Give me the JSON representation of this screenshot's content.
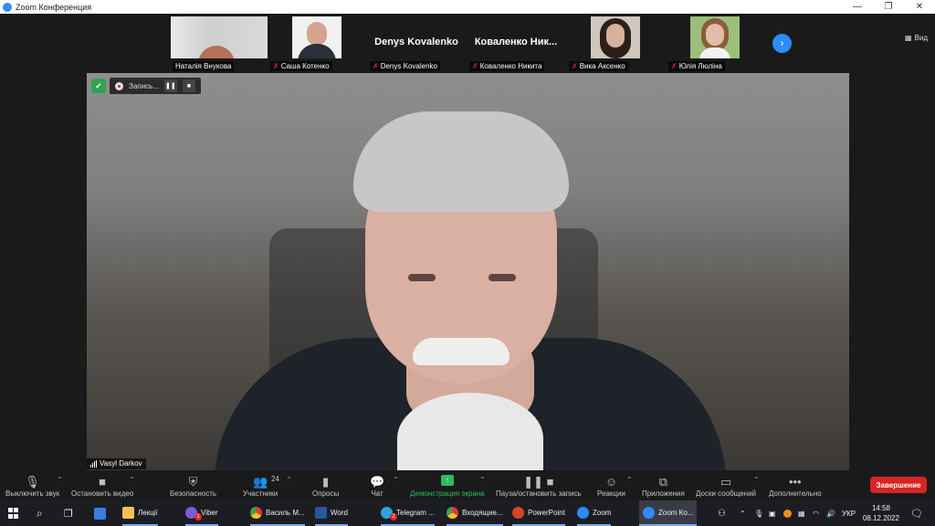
{
  "window": {
    "title": "Zoom Конференция"
  },
  "gallery": {
    "participants": [
      {
        "name": "Наталія Внукова",
        "muted": false,
        "video": true
      },
      {
        "name": "Саша Котенко",
        "muted": true,
        "video": true
      },
      {
        "name": "Denys Kovalenko",
        "muted": true,
        "video": false,
        "display": "Denys Kovalenko"
      },
      {
        "name": "Коваленко Никита",
        "muted": true,
        "video": false,
        "display": "Коваленко Ник..."
      },
      {
        "name": "Вика Аксенко",
        "muted": true,
        "video": true
      },
      {
        "name": "Юлія Люліна",
        "muted": true,
        "video": true
      }
    ],
    "view_label": "Вид"
  },
  "recording": {
    "label": "Запись..."
  },
  "speaker": {
    "name": "Vasyl Darkov"
  },
  "toolbar": {
    "mute_label": "Выключить звук",
    "video_label": "Остановить видео",
    "security_label": "Безопасность",
    "participants_label": "Участники",
    "participants_count": "24",
    "polls_label": "Опросы",
    "chat_label": "Чат",
    "share_label": "Демонстрация экрана",
    "record_label": "Пауза/остановить запись",
    "reactions_label": "Реакции",
    "apps_label": "Приложения",
    "whiteboards_label": "Доски сообщений",
    "more_label": "Дополнительно",
    "end_label": "Завершение"
  },
  "taskbar": {
    "apps": [
      {
        "label": "Лекції"
      },
      {
        "label": "Viber",
        "badge": "1"
      },
      {
        "label": "Василь М..."
      },
      {
        "label": "Word"
      },
      {
        "label": "Telegram ...",
        "badge": "2"
      },
      {
        "label": "Входящие..."
      },
      {
        "label": "PowerPoint"
      },
      {
        "label": "Zoom"
      },
      {
        "label": "Zoom Ко..."
      }
    ],
    "language": "УКР",
    "time": "14:58",
    "date": "08.12.2022"
  },
  "colors": {
    "zoom_blue": "#2d8cff",
    "share_green": "#2ebd5a",
    "end_red": "#d92323",
    "mute_red": "#e02828"
  }
}
